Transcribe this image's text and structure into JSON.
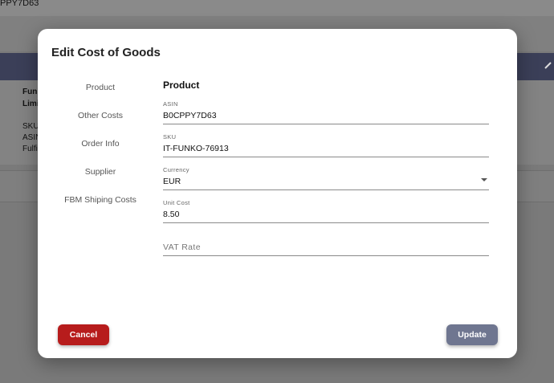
{
  "background": {
    "partial_id": "PPY7D63",
    "text_lines": [
      "Funl",
      "Limi",
      "SKU",
      "ASIN",
      "Fulfi"
    ]
  },
  "dialog": {
    "title": "Edit Cost of Goods",
    "nav_items": [
      "Product",
      "Other Costs",
      "Order Info",
      "Supplier",
      "FBM Shiping Costs"
    ],
    "section_title": "Product",
    "fields": {
      "asin": {
        "label": "ASIN",
        "value": "B0CPPY7D63"
      },
      "sku": {
        "label": "SKU",
        "value": "IT-FUNKO-76913"
      },
      "currency": {
        "label": "Currency",
        "value": "EUR"
      },
      "unit_cost": {
        "label": "Unit Cost",
        "value": "8.50"
      },
      "vat_rate": {
        "placeholder": "VAT Rate",
        "value": ""
      }
    },
    "buttons": {
      "cancel": "Cancel",
      "update": "Update"
    }
  },
  "colors": {
    "cancel": "#b71c1c",
    "update": "#6f7690",
    "header": "#3b3f58"
  }
}
